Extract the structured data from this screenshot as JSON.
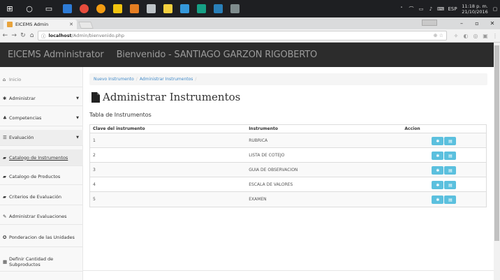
{
  "taskbar": {
    "clock_time": "11:18 p. m.",
    "clock_date": "21/10/2016",
    "lang": "ESP"
  },
  "browser": {
    "tab_title": "EICEMS Admin",
    "url_host": "localhost",
    "url_path": "/Admin/bienvenido.php"
  },
  "navbar": {
    "brand": "EICEMS Administrator",
    "welcome": "Bienvenido - SANTIAGO GARZON RIGOBERTO"
  },
  "sidebar": {
    "items": [
      {
        "label": "Inicio"
      },
      {
        "label": "Administrar"
      },
      {
        "label": "Competencias"
      },
      {
        "label": "Evaluación"
      },
      {
        "label": "Catalogo de Instrumentos"
      },
      {
        "label": "Catalogo de Productos"
      },
      {
        "label": "Criterios de Evaluación"
      },
      {
        "label": "Administrar Evaluaciones"
      },
      {
        "label": "Ponderacion de las Unidades"
      },
      {
        "label": "Definir Cantidad de Subproductos"
      }
    ]
  },
  "breadcrumb": {
    "items": [
      "Nuevo Instrumento",
      "Administrar Instrumentos"
    ]
  },
  "page": {
    "title": "Administrar Instrumentos",
    "section_label": "Tabla de Instrumentos"
  },
  "table": {
    "headers": [
      "Clave del instrumento",
      "Instrumento",
      "Accion"
    ],
    "rows": [
      {
        "clave": "1",
        "instrumento": "RUBRICA"
      },
      {
        "clave": "2",
        "instrumento": "LISTA DE COTEJO"
      },
      {
        "clave": "3",
        "instrumento": "GUIA DE OBSERVACION"
      },
      {
        "clave": "4",
        "instrumento": "ESCALA DE VALORES"
      },
      {
        "clave": "5",
        "instrumento": "EXAMEN"
      }
    ]
  },
  "colors": {
    "navbar_bg": "#2c2c2c",
    "action_button": "#5bc0de",
    "breadcrumb_link": "#428bca"
  }
}
